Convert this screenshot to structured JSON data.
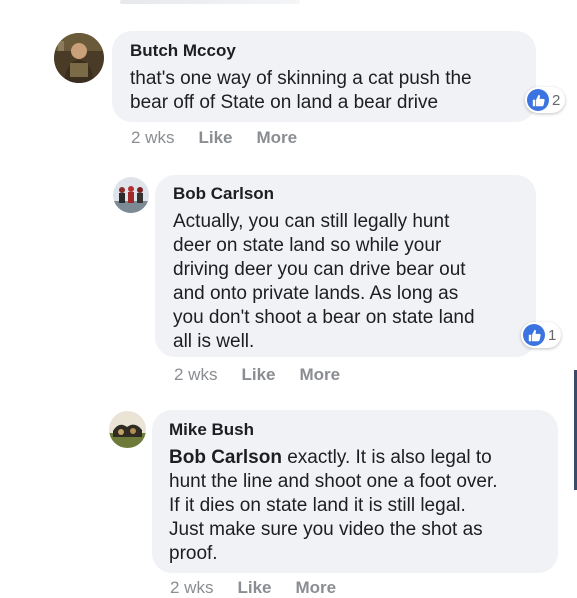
{
  "comments": [
    {
      "author": "Butch Mccoy",
      "text": "that's one way of skinning a cat push the\nbear off of State on land a bear drive",
      "reaction_count": "2",
      "time": "2 wks",
      "like_label": "Like",
      "more_label": "More"
    },
    {
      "author": "Bob Carlson",
      "text": "Actually, you can still legally hunt\ndeer on state land so while your\ndriving deer you can drive bear out\nand onto private lands. As long as\nyou don't shoot a bear on state land\nall is well.",
      "reaction_count": "1",
      "time": "2 wks",
      "like_label": "Like",
      "more_label": "More"
    },
    {
      "author": "Mike Bush",
      "mention": "Bob Carlson",
      "text": " exactly. It is also legal to\nhunt the line and shoot one a foot over.\nIf it dies on state land it is still legal.\nJust make sure you video the shot as\nproof.",
      "time": "2 wks",
      "like_label": "Like",
      "more_label": "More"
    }
  ],
  "colors": {
    "bubble": "#f0f2f5",
    "like_blue": "#3b73e0",
    "meta_gray": "#8a8d91"
  },
  "icons": {
    "reaction": "thumbs-up-icon"
  }
}
